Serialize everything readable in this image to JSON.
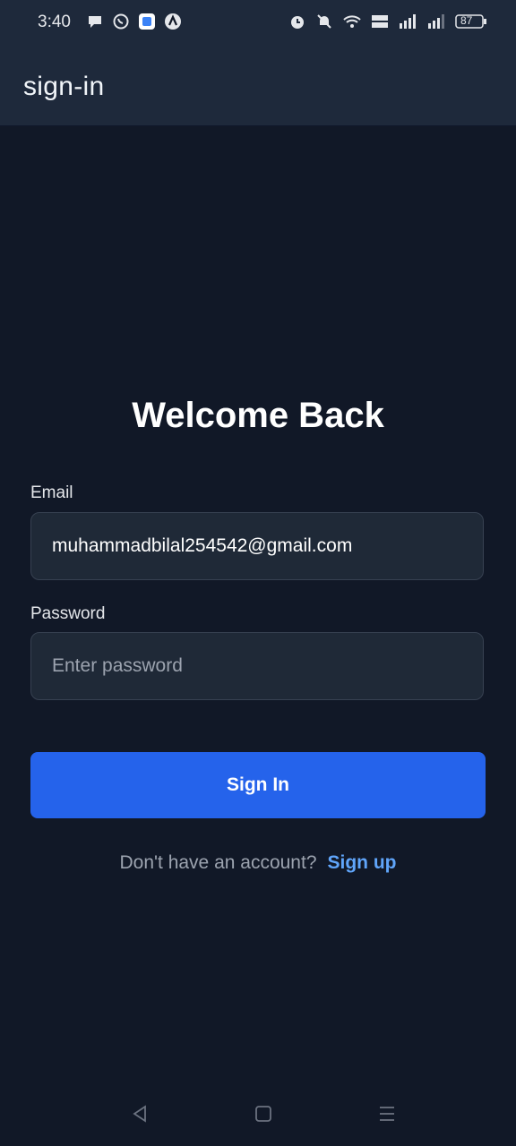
{
  "status_bar": {
    "time": "3:40",
    "battery": "87",
    "icons_left": [
      "chat-bubble-icon",
      "whatsapp-icon",
      "app-icon",
      "app-icon-2"
    ],
    "icons_right": [
      "alarm-icon",
      "mute-icon",
      "wifi-icon",
      "volte-icon",
      "signal-icon",
      "signal-icon-2",
      "battery-icon"
    ]
  },
  "app_bar": {
    "title": "sign-in"
  },
  "form": {
    "heading": "Welcome Back",
    "email_label": "Email",
    "email_value": "muhammadbilal254542@gmail.com",
    "password_label": "Password",
    "password_placeholder": "Enter password",
    "submit_label": "Sign In",
    "signup_prompt": "Don't have an account?",
    "signup_link": "Sign up"
  },
  "colors": {
    "background": "#111827",
    "app_bar": "#1e293b",
    "input_bg": "#1f2937",
    "button": "#2563eb",
    "link": "#60a5fa"
  },
  "nav_bar": {
    "icons": [
      "back-icon",
      "home-icon",
      "recents-icon"
    ]
  }
}
